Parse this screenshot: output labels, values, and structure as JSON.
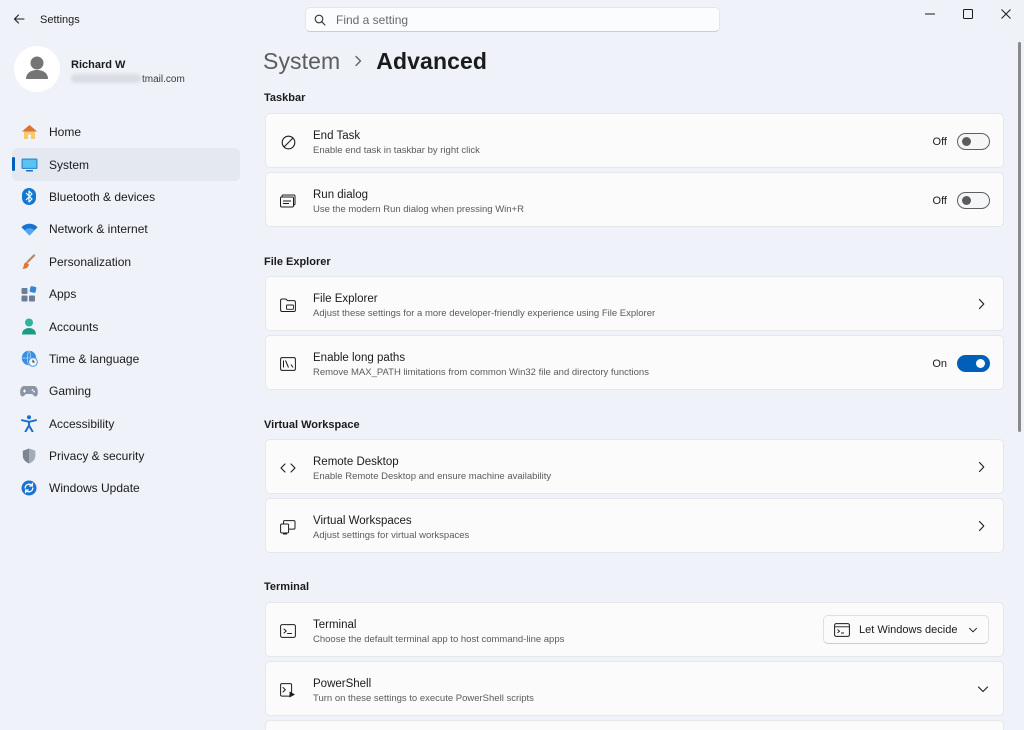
{
  "window": {
    "title": "Settings",
    "search_placeholder": "Find a setting"
  },
  "profile": {
    "name": "Richard W",
    "email_suffix": "tmail.com"
  },
  "sidebar": {
    "items": [
      {
        "label": "Home",
        "icon": "home-icon"
      },
      {
        "label": "System",
        "icon": "system-icon",
        "active": true
      },
      {
        "label": "Bluetooth & devices",
        "icon": "bluetooth-icon"
      },
      {
        "label": "Network & internet",
        "icon": "wifi-icon"
      },
      {
        "label": "Personalization",
        "icon": "brush-icon"
      },
      {
        "label": "Apps",
        "icon": "apps-icon"
      },
      {
        "label": "Accounts",
        "icon": "accounts-icon"
      },
      {
        "label": "Time & language",
        "icon": "globe-clock-icon"
      },
      {
        "label": "Gaming",
        "icon": "gamepad-icon"
      },
      {
        "label": "Accessibility",
        "icon": "accessibility-icon"
      },
      {
        "label": "Privacy & security",
        "icon": "shield-icon"
      },
      {
        "label": "Windows Update",
        "icon": "update-icon"
      }
    ]
  },
  "breadcrumb": {
    "parent": "System",
    "current": "Advanced"
  },
  "sections": {
    "taskbar": {
      "title": "Taskbar",
      "end_task": {
        "title": "End Task",
        "desc": "Enable end task in taskbar by right click",
        "state": "Off"
      },
      "run_dialog": {
        "title": "Run dialog",
        "desc": "Use the modern Run dialog when pressing Win+R",
        "state": "Off"
      }
    },
    "file_explorer": {
      "title": "File Explorer",
      "file_explorer": {
        "title": "File Explorer",
        "desc": "Adjust these settings for a more developer-friendly experience using File Explorer"
      },
      "long_paths": {
        "title": "Enable long paths",
        "desc": "Remove MAX_PATH limitations from common Win32 file and directory functions",
        "state": "On"
      }
    },
    "virtual_workspace": {
      "title": "Virtual Workspace",
      "remote_desktop": {
        "title": "Remote Desktop",
        "desc": "Enable Remote Desktop and ensure machine availability"
      },
      "virtual_workspaces": {
        "title": "Virtual Workspaces",
        "desc": "Adjust settings for virtual workspaces"
      }
    },
    "terminal": {
      "title": "Terminal",
      "terminal": {
        "title": "Terminal",
        "desc": "Choose the default terminal app to host command-line apps",
        "selected": "Let Windows decide"
      },
      "powershell": {
        "title": "PowerShell",
        "desc": "Turn on these settings to execute PowerShell scripts"
      }
    }
  },
  "colors": {
    "accent": "#005fb8",
    "background": "#eff2f8",
    "card": "#fbfbfc"
  }
}
